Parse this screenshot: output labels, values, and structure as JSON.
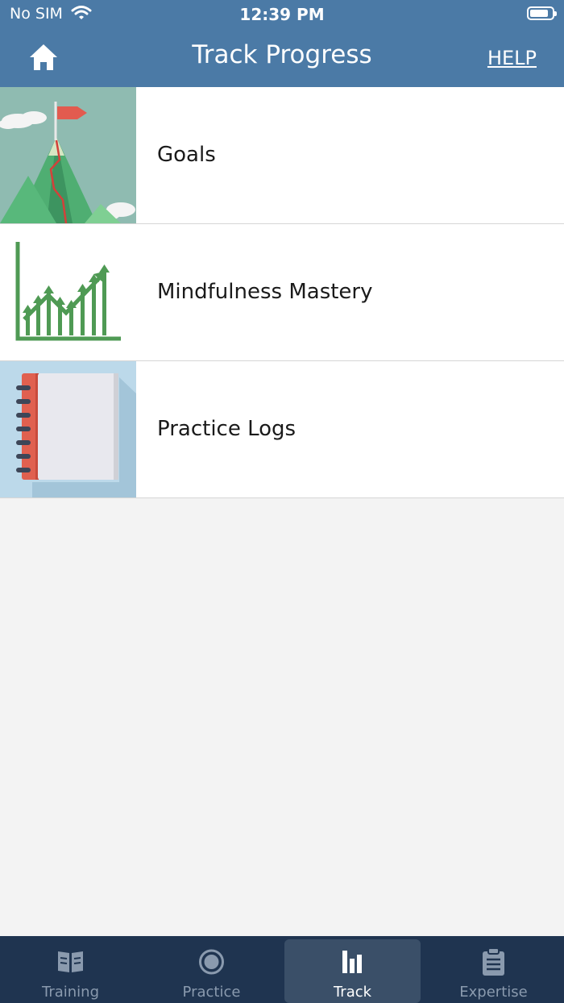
{
  "status": {
    "carrier": "No SIM",
    "time": "12:39 PM"
  },
  "header": {
    "title": "Track Progress",
    "help": "HELP"
  },
  "items": [
    {
      "label": "Goals"
    },
    {
      "label": "Mindfulness Mastery"
    },
    {
      "label": "Practice Logs"
    }
  ],
  "tabs": [
    {
      "label": "Training",
      "icon": "book-icon"
    },
    {
      "label": "Practice",
      "icon": "circle-icon"
    },
    {
      "label": "Track",
      "icon": "bar-chart-icon",
      "active": true
    },
    {
      "label": "Expertise",
      "icon": "clipboard-icon"
    }
  ],
  "colors": {
    "header": "#4b7aa6",
    "tabbar": "#1f3450",
    "background": "#f3f3f3"
  }
}
